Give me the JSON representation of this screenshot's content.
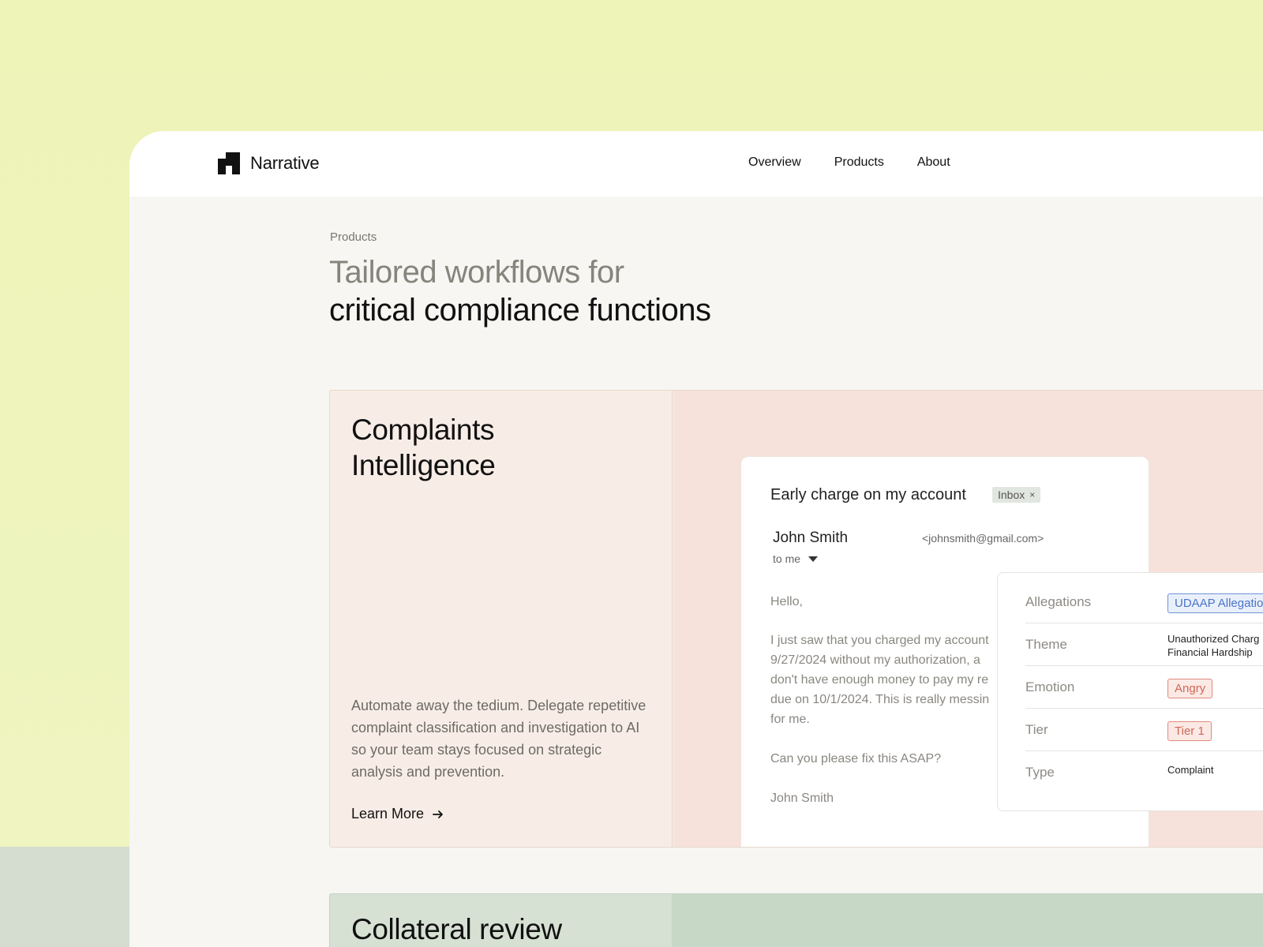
{
  "brand": {
    "name": "Narrative",
    "logo_icon": "narrative-logo-icon"
  },
  "nav": {
    "items": [
      "Overview",
      "Products",
      "About"
    ]
  },
  "hero": {
    "eyebrow": "Products",
    "line1": "Tailored workflows for",
    "line2": "critical compliance functions"
  },
  "card1": {
    "title_line1": "Complaints",
    "title_line2": "Intelligence",
    "description": "Automate away the tedium. Delegate repetitive complaint classification and investigation to AI so your team stays focused on strategic analysis and prevention.",
    "cta": "Learn More",
    "cta_icon": "arrow-right-icon"
  },
  "email": {
    "subject": "Early charge on my account",
    "tag": "Inbox",
    "tag_close": "×",
    "sender_name": "John Smith",
    "sender_email": "<johnsmith@gmail.com>",
    "to": "to me",
    "greeting": "Hello,",
    "paragraph": "I just saw that you charged my account 9/27/2024 without my authorization, a don't have enough money to pay my re due on 10/1/2024. This is really messin for me.",
    "question": "Can you please fix this ASAP?",
    "signature": "John Smith"
  },
  "attributes": {
    "allegations_label": "Allegations",
    "allegations_value": "UDAAP Allegatio",
    "theme_label": "Theme",
    "theme_value_1": "Unauthorized Charg",
    "theme_value_2": "Financial Hardship",
    "emotion_label": "Emotion",
    "emotion_value": "Angry",
    "tier_label": "Tier",
    "tier_value": "Tier 1",
    "type_label": "Type",
    "type_value": "Complaint"
  },
  "card2": {
    "title": "Collateral review"
  },
  "colors": {
    "page_bg": "#eef3b8",
    "card1_left": "#f7ede6",
    "card1_right": "#f6e2db",
    "card2_bg": "#cddbcc",
    "pill_blue": "#4a74c9",
    "pill_red": "#d26656"
  }
}
